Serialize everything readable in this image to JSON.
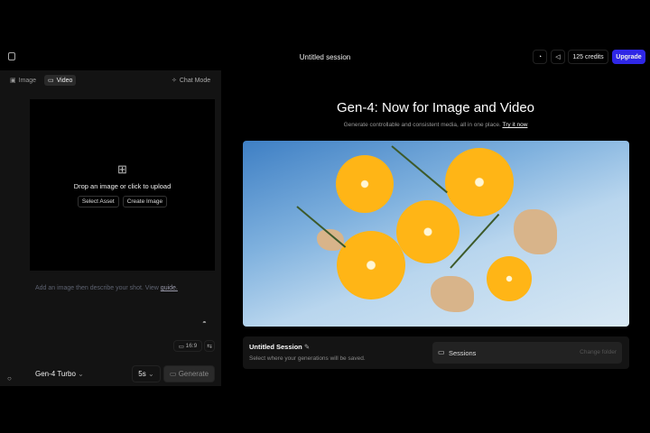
{
  "header": {
    "title": "Untitled session",
    "credits": "125 credits",
    "upgrade": "Upgrade"
  },
  "left": {
    "tabs": [
      {
        "label": "Image"
      },
      {
        "label": "Video"
      }
    ],
    "chat_mode": "Chat Mode",
    "dropzone": {
      "text": "Drop an image or click to upload",
      "select_asset": "Select Asset",
      "create_image": "Create Image"
    },
    "prompt_placeholder": "Add an image then describe your shot. View",
    "guide_link": "guide.",
    "aspect": "16:9",
    "model": "Gen-4 Turbo",
    "duration": "5s",
    "generate": "Generate"
  },
  "main": {
    "title": "Gen-4: Now for Image and Video",
    "subtitle": "Generate controllable and consistent media, all in one place.",
    "try_link": "Try it now",
    "session": {
      "name": "Untitled Session",
      "description": "Select where your generations will be saved.",
      "folder": "Sessions",
      "change_folder": "Change folder"
    }
  },
  "colors": {
    "accent": "#2f27e6",
    "panel": "#131313"
  }
}
